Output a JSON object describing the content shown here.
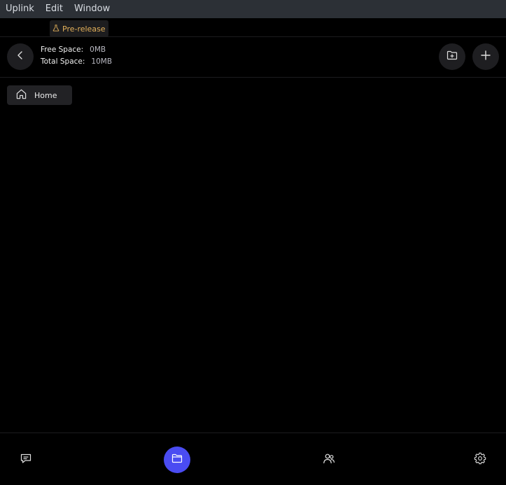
{
  "menubar": {
    "items": [
      "Uplink",
      "Edit",
      "Window"
    ]
  },
  "badge": {
    "label": "Pre-release",
    "color": "#e5b25b",
    "icon": "flask-icon"
  },
  "storage": {
    "free_label": "Free Space:",
    "free_value": "0MB",
    "total_label": "Total Space:",
    "total_value": "10MB"
  },
  "toolbar": {
    "back_icon": "chevron-left-icon",
    "new_folder_icon": "folder-plus-icon",
    "add_icon": "plus-icon"
  },
  "breadcrumb": {
    "items": [
      {
        "label": "Home",
        "icon": "home-icon"
      }
    ]
  },
  "bottom_nav": {
    "items": [
      {
        "name": "chats",
        "icon": "chat-icon",
        "active": false
      },
      {
        "name": "files",
        "icon": "folder-icon",
        "active": true
      },
      {
        "name": "friends",
        "icon": "users-icon",
        "active": false
      },
      {
        "name": "settings",
        "icon": "gear-icon",
        "active": false
      }
    ],
    "active_color": "#4a4cf2"
  }
}
